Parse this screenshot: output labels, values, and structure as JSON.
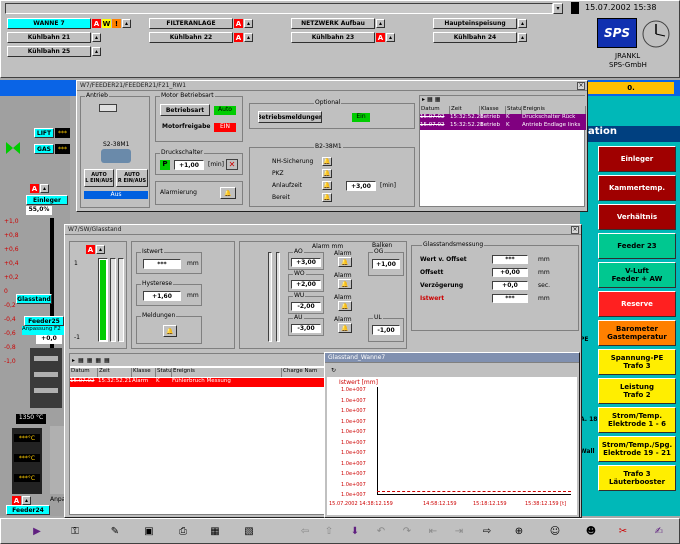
{
  "header": {
    "datetime": "15.07.2002 15:38",
    "tabs_row1": [
      "WANNE 7",
      "FILTERANLAGE",
      "NETZWERK Aufbau",
      "Haupteinspeisung"
    ],
    "tabs_row2": [
      "Kühlbahn 21",
      "Kühlbahn 22",
      "Kühlbahn 23",
      "Kühlbahn 24"
    ],
    "tabs_row3": [
      "Kühlbahn 25"
    ],
    "badges": {
      "a": "A",
      "w": "W",
      "f": "!"
    },
    "company_line1": "JRANKL",
    "company_line2": "SPS-GmbH",
    "logo": "SPS"
  },
  "blue_bar": {
    "value": "0."
  },
  "left_panel": {
    "lift": "LIFT",
    "gas": "GAS",
    "lift_val": "***",
    "gas_val": "***",
    "einleger": "Einleger",
    "percent": "55,0%",
    "scale": [
      "+1,0",
      "+0,8",
      "+0,6",
      "+0,4",
      "+0,2",
      "0",
      "-0,2",
      "-0,4",
      "-0,6",
      "-0,8",
      "-1,0"
    ],
    "glasstand": "Glasstand",
    "feeder25": "Feeder25",
    "anpassung": "Anpassung F2",
    "anp_val": "+0,0",
    "temp": "1350 °C",
    "temp_rows": [
      "***°C",
      "***°C",
      "***°C"
    ],
    "feeder24": "Feeder24",
    "anpa": "Anpa"
  },
  "right_panel": {
    "title": "ation",
    "buttons": [
      {
        "label": "Einleger",
        "color": "#a00000"
      },
      {
        "label": "Kammertemp.",
        "color": "#a00000"
      },
      {
        "label": "Verhältnis",
        "color": "#a00000"
      },
      {
        "label": "Feeder 23",
        "color": "#00c890"
      },
      {
        "label": "V-Luft\nFeeder + AW",
        "color": "#00c890"
      },
      {
        "label": "Reserve",
        "color": "#ff2020"
      },
      {
        "label": "Barometer\nGastemperatur",
        "color": "#ff8000"
      },
      {
        "label": "Spannung-PE\nTrafo 3",
        "color": "#ffee00"
      },
      {
        "label": "Leistung\nTrafo 2",
        "color": "#ffee00"
      },
      {
        "label": "Strom/Temp.\nElektrode 1 - 6",
        "color": "#ffee00"
      },
      {
        "label": "Strom/Temp./Spg.\nElektrode 19 - 21",
        "color": "#ffee00"
      },
      {
        "label": "Trafo 3\nLäuterbooster",
        "color": "#ffee00"
      }
    ],
    "left_partials": [
      "PE",
      "A.\n18",
      "Wall"
    ]
  },
  "feeder_window": {
    "title": "W7/FEEDER21/FEEDER21/F21_RW1",
    "antrieb": "Antrieb",
    "motor_betriebsart": "Motor Betriebsart",
    "betriebsart": "Betriebsart",
    "auto": "Auto",
    "motorfreigabe": "Motorfreigabe",
    "ein": "EIN",
    "s2": "S2-38M1",
    "auto_l": "AUTO\nL EIN/AUS",
    "auto_r": "AUTO\nR EIN/AUS",
    "aus": "Aus",
    "druckschalter": "Druckschalter",
    "p": "P",
    "druck_val": "+1,00",
    "druck_unit": "[min]",
    "alarmierung": "Alarmierung",
    "optional": "Optional",
    "betriebsmeldungen": "Betriebsmeldungen",
    "ein2": "Ein",
    "b2": "B2-38M1",
    "rows": [
      "NH-Sicherung",
      "PKZ",
      "Anlaufzeit",
      "Bereit"
    ],
    "anlauf_val": "+3,00",
    "anlauf_unit": "[min]",
    "events_headers": [
      "Datum",
      "Zeit",
      "Klasse",
      "Status",
      "Ereignis"
    ],
    "events": [
      {
        "datum": "15.07.02",
        "zeit": "15:32:52.21",
        "klasse": "Betrieb",
        "status": "K",
        "ereignis": "Druckschalter Rück"
      },
      {
        "datum": "15.07.02",
        "zeit": "15:32:52.21",
        "klasse": "Betrieb",
        "status": "K",
        "ereignis": "Antrieb Endlage links"
      }
    ]
  },
  "glasstand_window": {
    "title": "W7/SW/Glasstand",
    "scale_top": "1",
    "scale_bottom": "-1",
    "istwert": "Istwert",
    "ist_val": "***",
    "mm": "mm",
    "hysterese": "Hysterese",
    "hyst_val": "+1,60",
    "meldungen": "Meldungen",
    "alarm_mm": "Alarm mm",
    "alarm": "Alarm",
    "limits": [
      {
        "name": "AO",
        "value": "+3,00"
      },
      {
        "name": "WO",
        "value": "+2,00"
      },
      {
        "name": "WU",
        "value": "-2,00"
      },
      {
        "name": "AU",
        "value": "-3,00"
      }
    ],
    "balken": "Balken",
    "og": "OG",
    "og_val": "+1,00",
    "ul": "UL",
    "ul_val": "-1,00",
    "messung": "Glasstandsmessung",
    "m_rows": [
      {
        "label": "Wert v. Offset",
        "value": "***",
        "unit": "mm"
      },
      {
        "label": "Offsett",
        "value": "+0,00",
        "unit": "mm"
      },
      {
        "label": "Verzögerung",
        "value": "+0,0",
        "unit": "sec."
      },
      {
        "label": "Istwert",
        "value": "***",
        "unit": "mm"
      }
    ],
    "alarm_headers": [
      "Datum",
      "Zeit",
      "Klasse",
      "Status",
      "Ereignis",
      "Charge Nam"
    ],
    "alarm_row": {
      "datum": "15.07.02",
      "zeit": "15:32:52.21",
      "klasse": "Alarm",
      "status": "K",
      "ereignis": "Fühlerbruch Messung"
    }
  },
  "trend_window": {
    "title": "Glasstand_Wanne7",
    "ylabel": "Istwert [mm]",
    "yticks": [
      "1.0e+007",
      "1.0e+007",
      "1.0e+007",
      "1.0e+007",
      "1.0e+007",
      "1.0e+007",
      "1.0e+007",
      "1.0e+007",
      "1.0e+007",
      "1.0e+007",
      "1.0e+007"
    ],
    "xticks": [
      "15.07.2002 14:38:12.159",
      "14:58:12.159",
      "15:18:12.159",
      "15:38:12.159 [t]"
    ]
  },
  "colors": {
    "accent_red": "#ff0000",
    "green": "#00cc00",
    "cyan": "#00ffff"
  }
}
